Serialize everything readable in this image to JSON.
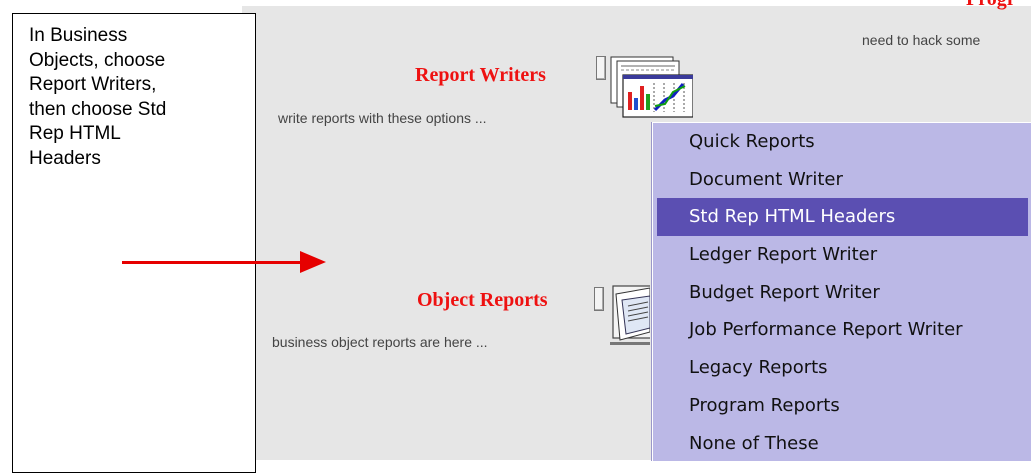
{
  "callout": {
    "text": "In Business\nObjects, choose\nReport Writers,\nthen choose Std\nRep HTML\nHeaders"
  },
  "programs_section": {
    "title": "Progr",
    "description": "need to hack some"
  },
  "report_writers": {
    "title": "Report Writers",
    "description": "write reports with these options ..."
  },
  "object_reports": {
    "title": "Object Reports",
    "description": "business object reports are here ..."
  },
  "menu": {
    "items": [
      {
        "label": "Quick Reports",
        "selected": false
      },
      {
        "label": "Document Writer",
        "selected": false
      },
      {
        "label": "Std Rep HTML Headers",
        "selected": true
      },
      {
        "label": "Ledger Report Writer",
        "selected": false
      },
      {
        "label": "Budget Report Writer",
        "selected": false
      },
      {
        "label": "Job Performance Report Writer",
        "selected": false
      },
      {
        "label": "Legacy Reports",
        "selected": false
      },
      {
        "label": "Program Reports",
        "selected": false
      },
      {
        "label": "None of These",
        "selected": false
      }
    ]
  },
  "colors": {
    "section_title": "#ee1111",
    "menu_background": "#bbb8e6",
    "menu_selected": "#5b4fb2",
    "arrow": "#e60000"
  },
  "icons": [
    "report-chart-icon",
    "object-reports-icon",
    "expand-toggle-icon"
  ]
}
